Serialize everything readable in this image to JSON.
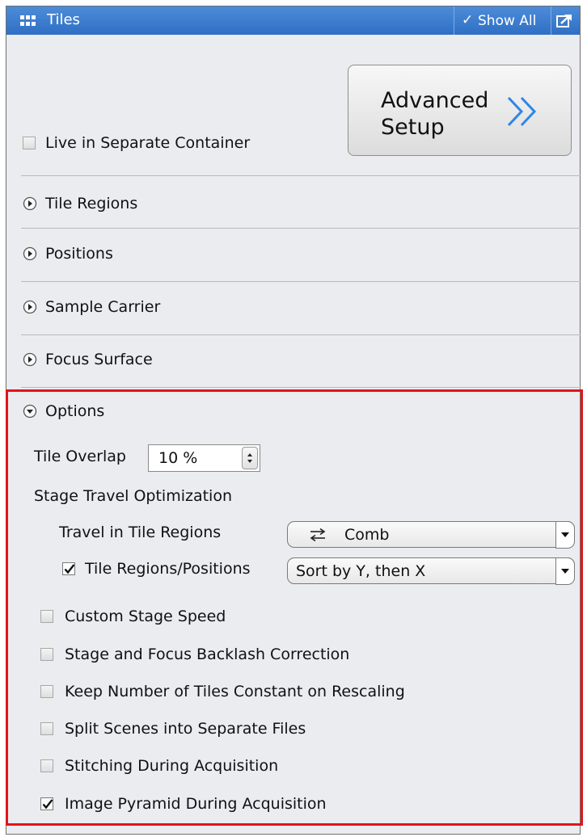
{
  "header": {
    "title": "Tiles",
    "show_all_label": "Show All",
    "icons": [
      "tiles-icon",
      "checkmark-icon",
      "undock-icon"
    ],
    "accent_color": "#3a7bd0"
  },
  "advanced_setup": {
    "line1": "Advanced",
    "line2": "Setup",
    "icon": "double-chevron-right-icon",
    "chevron_color": "#2e86e8"
  },
  "live_container": {
    "label": "Live in Separate Container",
    "checked": false
  },
  "sections": [
    {
      "label": "Tile Regions",
      "expanded": false
    },
    {
      "label": "Positions",
      "expanded": false
    },
    {
      "label": "Sample Carrier",
      "expanded": false
    },
    {
      "label": "Focus Surface",
      "expanded": false
    },
    {
      "label": "Options",
      "expanded": true
    }
  ],
  "options": {
    "tile_overlap": {
      "label": "Tile Overlap",
      "value": "10 %"
    },
    "stage_travel": {
      "heading": "Stage Travel Optimization",
      "travel_label": "Travel in Tile Regions",
      "travel_value": "Comb",
      "travel_icon": "comb-travel-icon",
      "regions_label": "Tile Regions/Positions",
      "regions_checked": true,
      "regions_value": "Sort by Y, then X"
    },
    "checkboxes": [
      {
        "label": "Custom Stage Speed",
        "checked": false
      },
      {
        "label": "Stage and Focus Backlash Correction",
        "checked": false
      },
      {
        "label": "Keep Number of Tiles Constant on Rescaling",
        "checked": false
      },
      {
        "label": "Split Scenes into Separate Files",
        "checked": false
      },
      {
        "label": "Stitching During Acquisition",
        "checked": false
      },
      {
        "label": "Image Pyramid During Acquisition",
        "checked": true
      }
    ]
  },
  "highlight_color": "#e2141b"
}
